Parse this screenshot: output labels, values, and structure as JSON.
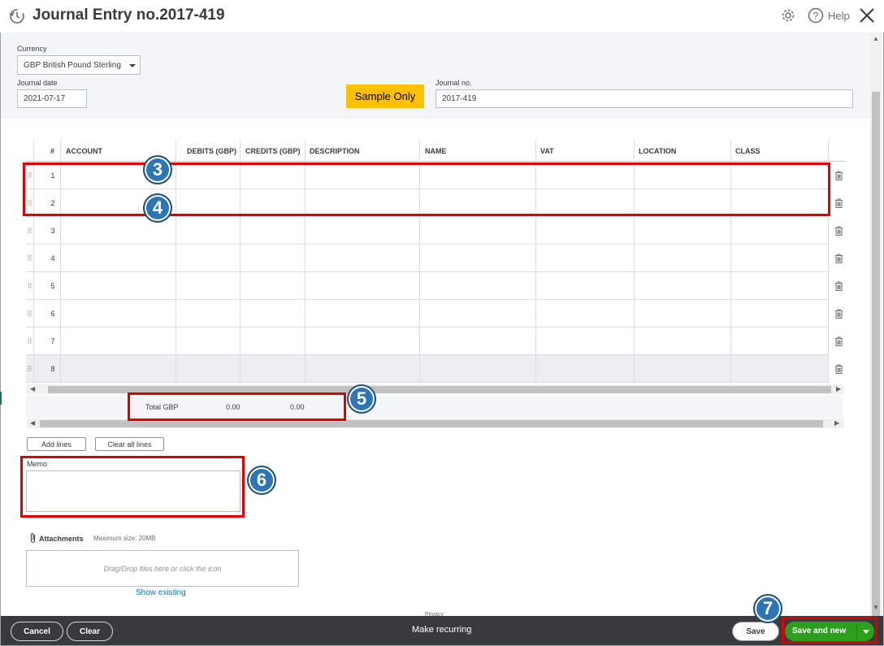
{
  "title": "Journal Entry no.2017-419",
  "help_label": "Help",
  "header": {
    "currency_label": "Currency",
    "currency_value": "GBP British Pound Sterling",
    "journal_date_label": "Journal date",
    "journal_date_value": "2021-07-17",
    "sample_label": "Sample Only",
    "journal_no_label": "Journal no.",
    "journal_no_value": "2017-419"
  },
  "grid": {
    "columns": [
      "#",
      "ACCOUNT",
      "DEBITS (GBP)",
      "CREDITS (GBP)",
      "DESCRIPTION",
      "NAME",
      "VAT",
      "LOCATION",
      "CLASS"
    ],
    "rows": [
      "1",
      "2",
      "3",
      "4",
      "5",
      "6",
      "7",
      "8"
    ]
  },
  "totals": {
    "label": "Total GBP",
    "debits": "0.00",
    "credits": "0.00"
  },
  "buttons": {
    "add_lines": "Add lines",
    "clear_all_lines": "Clear all lines"
  },
  "memo_label": "Memo",
  "attachments": {
    "label": "Attachments",
    "max_size": "Maximum size: 20MB",
    "drop_hint": "Drag/Drop files here or click the icon",
    "show_existing": "Show existing"
  },
  "privacy": "Privacy",
  "footer": {
    "cancel": "Cancel",
    "clear": "Clear",
    "make_recurring": "Make recurring",
    "save": "Save",
    "save_and_new": "Save and new"
  },
  "annotations": [
    "3",
    "4",
    "5",
    "6",
    "7"
  ],
  "colors": {
    "accent_green": "#2ca01c",
    "sample_yellow": "#ffc000",
    "highlight_red": "#e00000",
    "badge_blue": "#2e75b6",
    "footer_dark": "#393a3d"
  }
}
